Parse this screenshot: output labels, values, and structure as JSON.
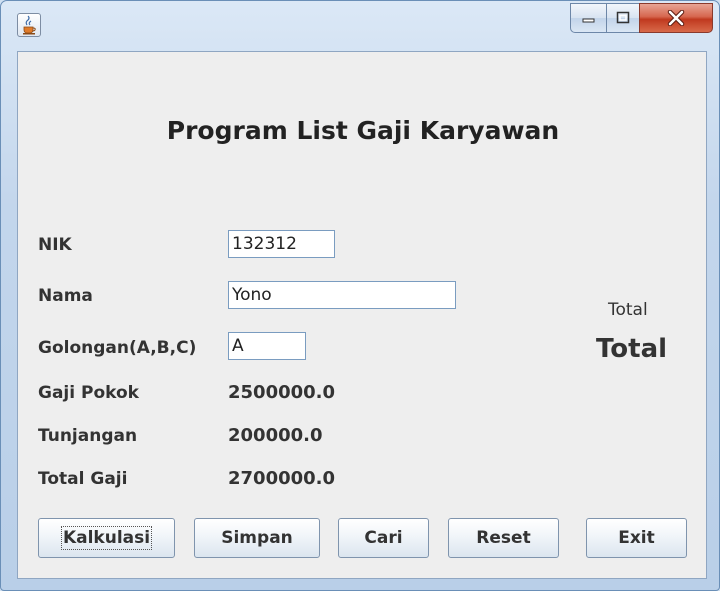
{
  "window": {
    "icon": "java-cup-icon",
    "controls": [
      "minimize-icon",
      "maximize-icon",
      "close-icon"
    ]
  },
  "form": {
    "title": "Program List Gaji Karyawan",
    "fields": {
      "nik": {
        "label": "NIK",
        "value": "132312"
      },
      "nama": {
        "label": "Nama",
        "value": "Yono"
      },
      "golongan": {
        "label": "Golongan(A,B,C)",
        "value": "A"
      }
    },
    "outputs": {
      "gaji_pokok": {
        "label": "Gaji Pokok",
        "value": "2500000.0"
      },
      "tunjangan": {
        "label": "Tunjangan",
        "value": "200000.0"
      },
      "total_gaji": {
        "label": "Total Gaji",
        "value": "2700000.0"
      }
    },
    "total": {
      "small_label": "Total",
      "big_label": "Total"
    }
  },
  "buttons": {
    "kalkulasi": "Kalkulasi",
    "simpan": "Simpan",
    "cari": "Cari",
    "reset": "Reset",
    "exit": "Exit"
  },
  "colors": {
    "content_bg": "#eeeeee",
    "close_button": "#c0391f",
    "field_border": "#7a9cc0"
  }
}
